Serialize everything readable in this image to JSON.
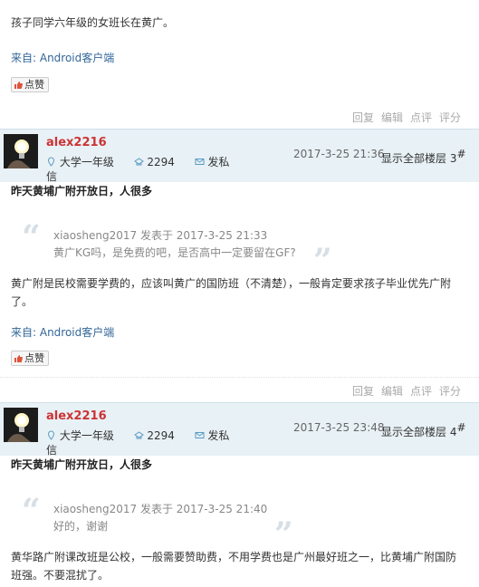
{
  "post0": {
    "body": "孩子同学六年级的女班长在黄广。",
    "from_prefix": "来自: ",
    "from_link": "Android客户端",
    "like": "点赞"
  },
  "actions": {
    "reply": "回复",
    "edit": "编辑",
    "rate": "点评",
    "score": "评分"
  },
  "post1": {
    "username": "alex2216",
    "grade": "大学一年级",
    "points": "2294",
    "pm": "发私",
    "pm_wrap": "信",
    "date": "2017-3-25 21:36",
    "show_all": "显示全部楼层",
    "floor_num": "3",
    "floor_mark": "#",
    "title": "昨天黄埔广附开放日，人很多",
    "quote_author": "xiaosheng2017 发表于 2017-3-25 21:33",
    "quote_text": "黄广KG吗，是免费的吧，是否高中一定要留在GF?",
    "body": "黄广附是民校需要学费的，应该叫黄广的国防班（不清楚），一般肯定要求孩子毕业优先广附了。",
    "from_prefix": "来自: ",
    "from_link": "Android客户端",
    "like": "点赞"
  },
  "post2": {
    "username": "alex2216",
    "grade": "大学一年级",
    "points": "2294",
    "pm": "发私",
    "pm_wrap": "信",
    "date": "2017-3-25 23:48",
    "show_all": "显示全部楼层",
    "floor_num": "4",
    "floor_mark": "#",
    "title": "昨天黄埔广附开放日，人很多",
    "quote_author": "xiaosheng2017 发表于 2017-3-25 21:40",
    "quote_text": "好的，谢谢",
    "body": "黄华路广附课改班是公校，一般需要赞助费，不用学费也是广州最好班之一，比黄埔广附国防班强。不要混扰了。"
  },
  "colors": {
    "username": "#cc3333",
    "link": "#336699",
    "header_bg": "#e8f1f6"
  }
}
